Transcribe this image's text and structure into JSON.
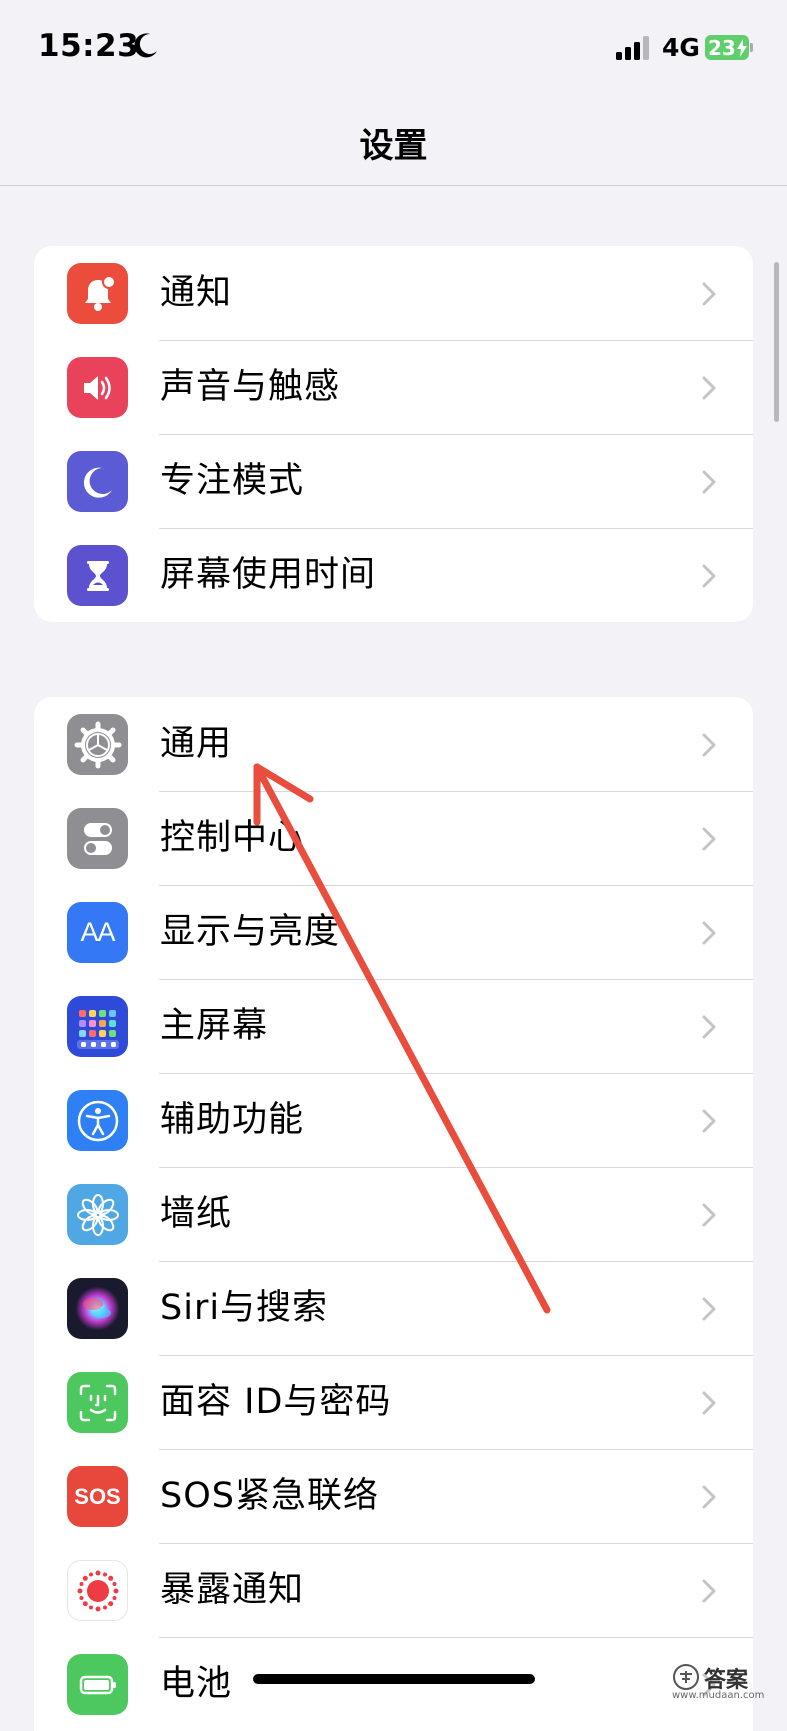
{
  "status_bar": {
    "time": "15:23",
    "network": "4G",
    "battery": "23"
  },
  "header": {
    "title": "设置"
  },
  "groups": [
    {
      "items": [
        {
          "label": "通知",
          "icon": "bell-icon",
          "color": "#ec4c3c"
        },
        {
          "label": "声音与触感",
          "icon": "speaker-icon",
          "color": "#e9435c"
        },
        {
          "label": "专注模式",
          "icon": "moon-icon",
          "color": "#5c5bd6"
        },
        {
          "label": "屏幕使用时间",
          "icon": "hourglass-icon",
          "color": "#5c52d0"
        }
      ]
    },
    {
      "items": [
        {
          "label": "通用",
          "icon": "gear-icon",
          "color": "#8e8e93"
        },
        {
          "label": "控制中心",
          "icon": "toggles-icon",
          "color": "#8e8e93"
        },
        {
          "label": "显示与亮度",
          "icon": "text-size-icon",
          "color": "#3478f6"
        },
        {
          "label": "主屏幕",
          "icon": "home-grid-icon",
          "color": "#2f49d8"
        },
        {
          "label": "辅助功能",
          "icon": "accessibility-icon",
          "color": "#2f7ff5"
        },
        {
          "label": "墙纸",
          "icon": "flower-icon",
          "color": "#4fa8e4"
        },
        {
          "label": "Siri与搜索",
          "icon": "siri-icon",
          "color": "#1a1a2e"
        },
        {
          "label": "面容 ID与密码",
          "icon": "face-id-icon",
          "color": "#4cc85e"
        },
        {
          "label": "SOS紧急联络",
          "icon": "sos-icon",
          "color": "#e8473b"
        },
        {
          "label": "暴露通知",
          "icon": "exposure-icon",
          "color": "#ffffff"
        },
        {
          "label": "电池",
          "icon": "battery-icon",
          "color": "#4cc85e"
        }
      ]
    }
  ],
  "sos_text": "SOS",
  "text_size_glyph": "AA",
  "watermark": {
    "text": "答案",
    "url": "www.mudaan.com"
  },
  "accent_arrow_color": "#e84d3d"
}
